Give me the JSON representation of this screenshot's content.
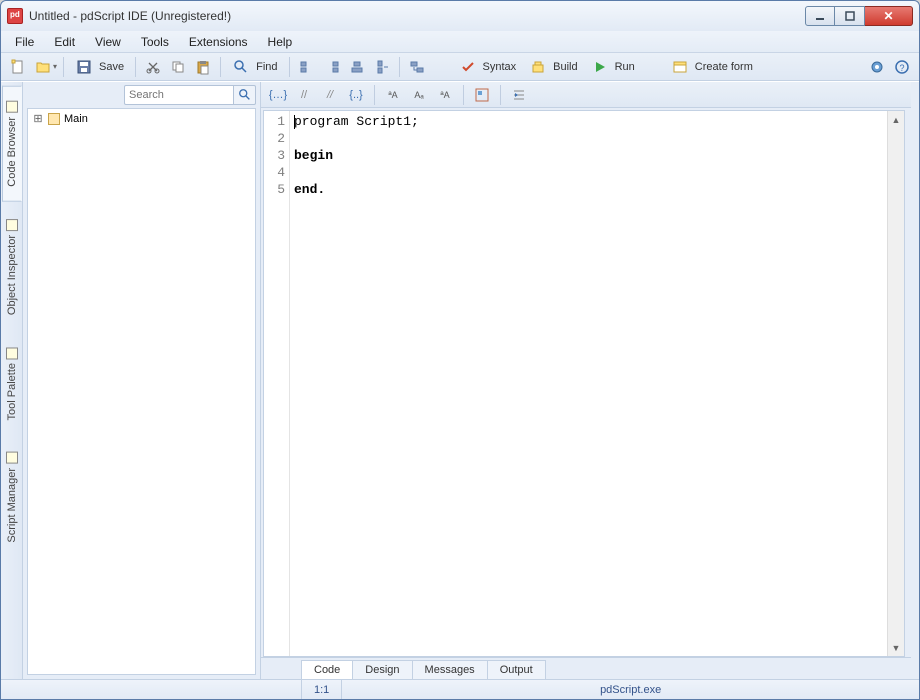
{
  "window": {
    "title": "Untitled - pdScript IDE (Unregistered!)"
  },
  "menu": [
    "File",
    "Edit",
    "View",
    "Tools",
    "Extensions",
    "Help"
  ],
  "toolbar": {
    "save_label": "Save",
    "find_label": "Find",
    "syntax_label": "Syntax",
    "build_label": "Build",
    "run_label": "Run",
    "create_form_label": "Create form"
  },
  "side_tabs": [
    "Code Browser",
    "Object Inspector",
    "Tool Palette",
    "Script Manager"
  ],
  "search": {
    "placeholder": "Search"
  },
  "tree": {
    "root": "Main"
  },
  "editor": {
    "lines": [
      "program Script1;",
      "",
      "begin",
      "",
      "end."
    ],
    "line_numbers": [
      "1",
      "2",
      "3",
      "4",
      "5"
    ]
  },
  "bottom_tabs": [
    "Code",
    "Design",
    "Messages",
    "Output"
  ],
  "status": {
    "cursor": "1:1",
    "interpreter": "pdScript.exe"
  }
}
